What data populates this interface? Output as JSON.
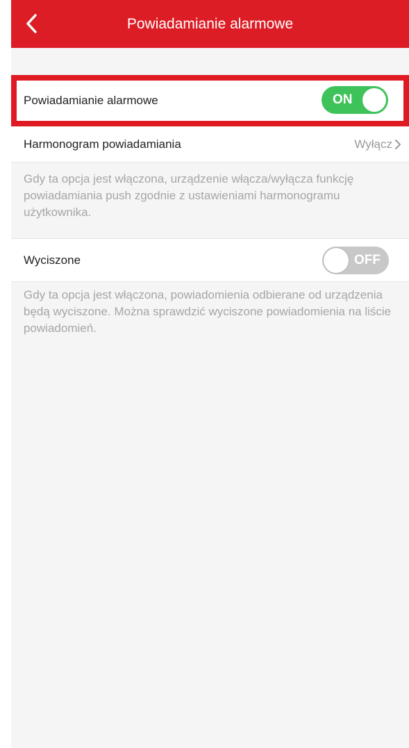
{
  "header": {
    "title": "Powiadamianie alarmowe",
    "back_icon": "chevron-left-icon",
    "background_color": "#dc1d25"
  },
  "alarm_notification": {
    "label": "Powiadamianie alarmowe",
    "toggle_state": "ON",
    "toggle_color": "#3ec25a",
    "highlight_color": "#e01a22"
  },
  "schedule": {
    "label": "Harmonogram powiadamiania",
    "value": "Wyłącz",
    "chevron_icon": "chevron-right-icon",
    "description": "Gdy ta opcja jest włączona, urządzenie włącza/wyłącza funkcję powiadamiania push zgodnie z ustawieniami harmonogramu użytkownika."
  },
  "muted": {
    "label": "Wyciszone",
    "toggle_state": "OFF",
    "toggle_color": "#c8c8c8",
    "description": "Gdy ta opcja jest włączona, powiadomienia odbierane od urządzenia będą wyciszone. Można sprawdzić wyciszone powiadomienia na liście powiadomień."
  }
}
